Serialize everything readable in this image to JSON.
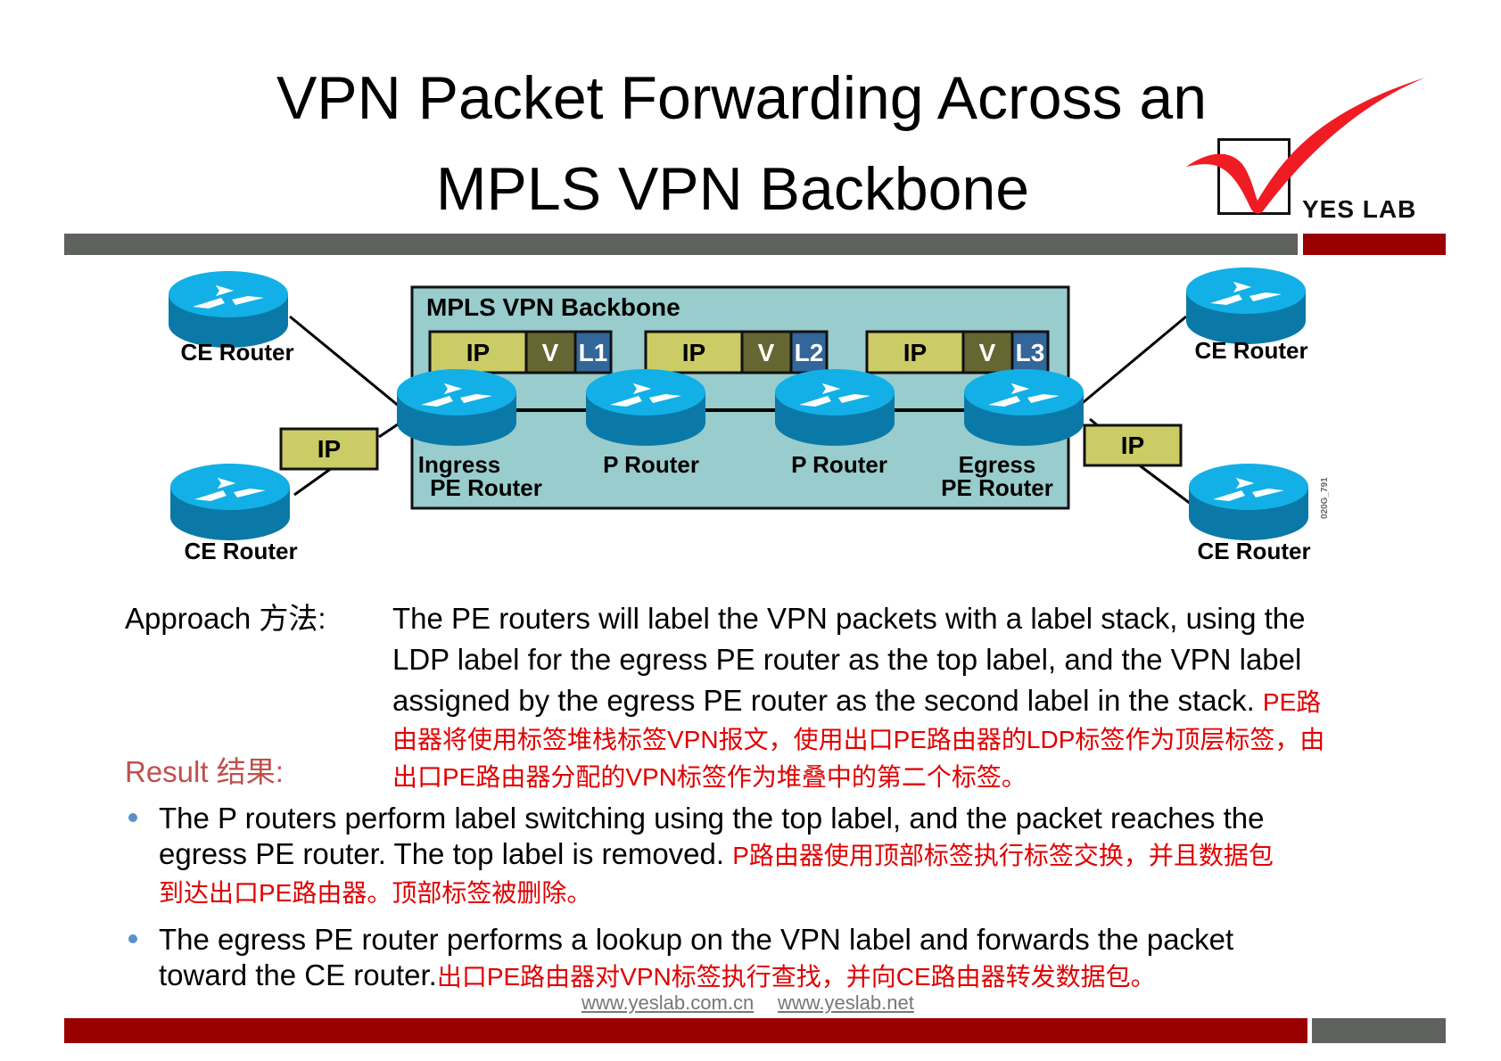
{
  "slide": {
    "title_line1": "VPN Packet Forwarding Across an",
    "title_line2": "MPLS VPN Backbone",
    "logo_text": "YES LAB",
    "colors": {
      "accent_red": "#9b0000",
      "bar_gray": "#5f615e",
      "backbone_fill": "#99cccc",
      "ip_fill": "#cccc66",
      "v_fill": "#666633",
      "label_fill": "#336699",
      "router_blue": "#0099cc"
    }
  },
  "diagram": {
    "backbone_title": "MPLS VPN Backbone",
    "stacks": [
      {
        "ip": "IP",
        "v": "V",
        "label": "L1"
      },
      {
        "ip": "IP",
        "v": "V",
        "label": "L2"
      },
      {
        "ip": "IP",
        "v": "V",
        "label": "L3"
      }
    ],
    "routers": [
      {
        "name": "Ingress",
        "name2": "PE Router"
      },
      {
        "name": "P Router",
        "name2": ""
      },
      {
        "name": "P Router",
        "name2": ""
      },
      {
        "name": "Egress",
        "name2": "PE Router"
      }
    ],
    "ce_left_top": "CE Router",
    "ce_left_bottom": "CE Router",
    "ce_right_top": "CE Router",
    "ce_right_bottom": "CE Router",
    "ip_left": "IP",
    "ip_right": "IP",
    "figure_id": "020G_791"
  },
  "approach": {
    "label": "Approach 方法:",
    "lines": [
      "The PE routers will label the VPN packets with a label stack, using the",
      "LDP label for the egress PE router as the top label, and the VPN label",
      "assigned by the egress PE router as the second label in the stack."
    ],
    "cn_tail": "PE路",
    "cn_lines": [
      "由器将使用标签堆栈标签VPN报文，使用出口PE路由器的LDP标签作为顶层标签，由",
      "出口PE路由器分配的VPN标签作为堆叠中的第二个标签。"
    ]
  },
  "result": {
    "label": "Result 结果:",
    "bullets": [
      {
        "line1": "The P routers perform label switching using the top label, and the packet reaches the",
        "line2": "egress PE router. The top label is removed.",
        "cn2": "P路由器使用顶部标签执行标签交换，并且数据包",
        "cn3": "到达出口PE路由器。顶部标签被删除。"
      },
      {
        "line1": "The egress PE router performs a lookup on the VPN label and forwards the packet",
        "line2": "toward the CE router.",
        "cn2": "出口PE路由器对VPN标签执行查找，并向CE路由器转发数据包。"
      }
    ]
  },
  "footer": {
    "link1": "www.yeslab.com.cn",
    "link2": "www.yeslab.net"
  }
}
